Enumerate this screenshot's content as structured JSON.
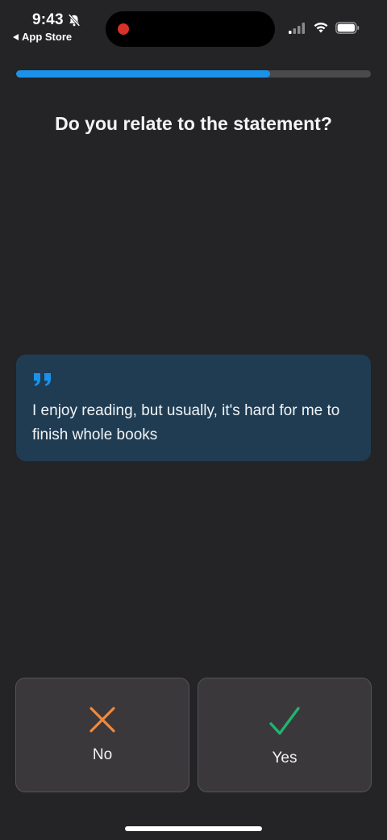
{
  "status_bar": {
    "time": "9:43",
    "back_label": "App Store",
    "icons": [
      "bell-slash-icon",
      "cellular-signal-icon",
      "wifi-icon",
      "battery-icon"
    ]
  },
  "progress": {
    "fraction": 0.715
  },
  "question": "Do you relate to the statement?",
  "quote": {
    "icon": "quote-icon",
    "text": "I enjoy reading, but usually, it's hard for me to finish whole books"
  },
  "answers": {
    "no": {
      "label": "No",
      "icon": "x-icon",
      "color": "#f08a3c"
    },
    "yes": {
      "label": "Yes",
      "icon": "checkmark-icon",
      "color": "#1fb56f"
    }
  },
  "colors": {
    "background": "#242326",
    "accent": "#1a92ea",
    "card": "#1f3c53"
  }
}
